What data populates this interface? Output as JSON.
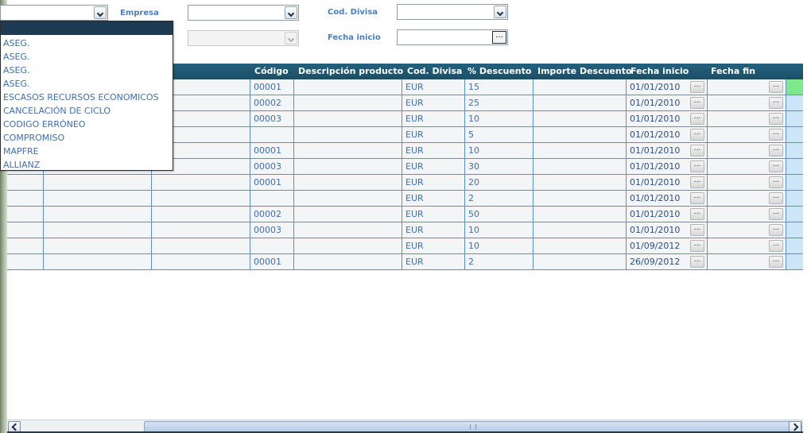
{
  "filters": {
    "empresa_label": "Empresa",
    "cod_divisa_label": "Cod. Divisa",
    "fecha_inicio_label": "Fecha inicio",
    "date_button": "..."
  },
  "dropdown": {
    "items": [
      "ASEG.",
      "ASEG.",
      "ASEG.",
      "ASEG.",
      "ESCASOS RECURSOS ECONOMICOS",
      "CANCELACIÓN DE CICLO",
      "CODIGO ERRÓNEO",
      "COMPROMISO",
      "MAPFRE",
      "ALLIANZ"
    ]
  },
  "table": {
    "headers": {
      "codigo": "Código",
      "descripcion": "Descripción producto",
      "cod_divisa": "Cod. Divisa",
      "descuento": "% Descuento",
      "importe": "Importe Descuento",
      "fecha_inicio": "Fecha inicio",
      "fecha_fin": "Fecha fin"
    },
    "button_label": "...",
    "rows": [
      {
        "codigo": "00001",
        "divisa": "EUR",
        "descuento": "15",
        "fecha_inicio": "01/01/2010",
        "active": true
      },
      {
        "codigo": "00002",
        "divisa": "EUR",
        "descuento": "25",
        "fecha_inicio": "01/01/2010"
      },
      {
        "codigo": "00003",
        "divisa": "EUR",
        "descuento": "10",
        "fecha_inicio": "01/01/2010"
      },
      {
        "codigo": "",
        "divisa": "EUR",
        "descuento": "5",
        "fecha_inicio": "01/01/2010"
      },
      {
        "codigo": "00001",
        "divisa": "EUR",
        "descuento": "10",
        "fecha_inicio": "01/01/2010"
      },
      {
        "codigo": "00003",
        "divisa": "EUR",
        "descuento": "30",
        "fecha_inicio": "01/01/2010"
      },
      {
        "codigo": "00001",
        "divisa": "EUR",
        "descuento": "20",
        "fecha_inicio": "01/01/2010"
      },
      {
        "codigo": "",
        "divisa": "EUR",
        "descuento": "2",
        "fecha_inicio": "01/01/2010"
      },
      {
        "codigo": "00002",
        "divisa": "EUR",
        "descuento": "50",
        "fecha_inicio": "01/01/2010"
      },
      {
        "codigo": "00003",
        "divisa": "EUR",
        "descuento": "10",
        "fecha_inicio": "01/01/2010"
      },
      {
        "codigo": "",
        "divisa": "EUR",
        "descuento": "10",
        "fecha_inicio": "01/09/2012"
      },
      {
        "codigo": "00001",
        "divisa": "EUR",
        "descuento": "2",
        "fecha_inicio": "26/09/2012"
      }
    ]
  }
}
